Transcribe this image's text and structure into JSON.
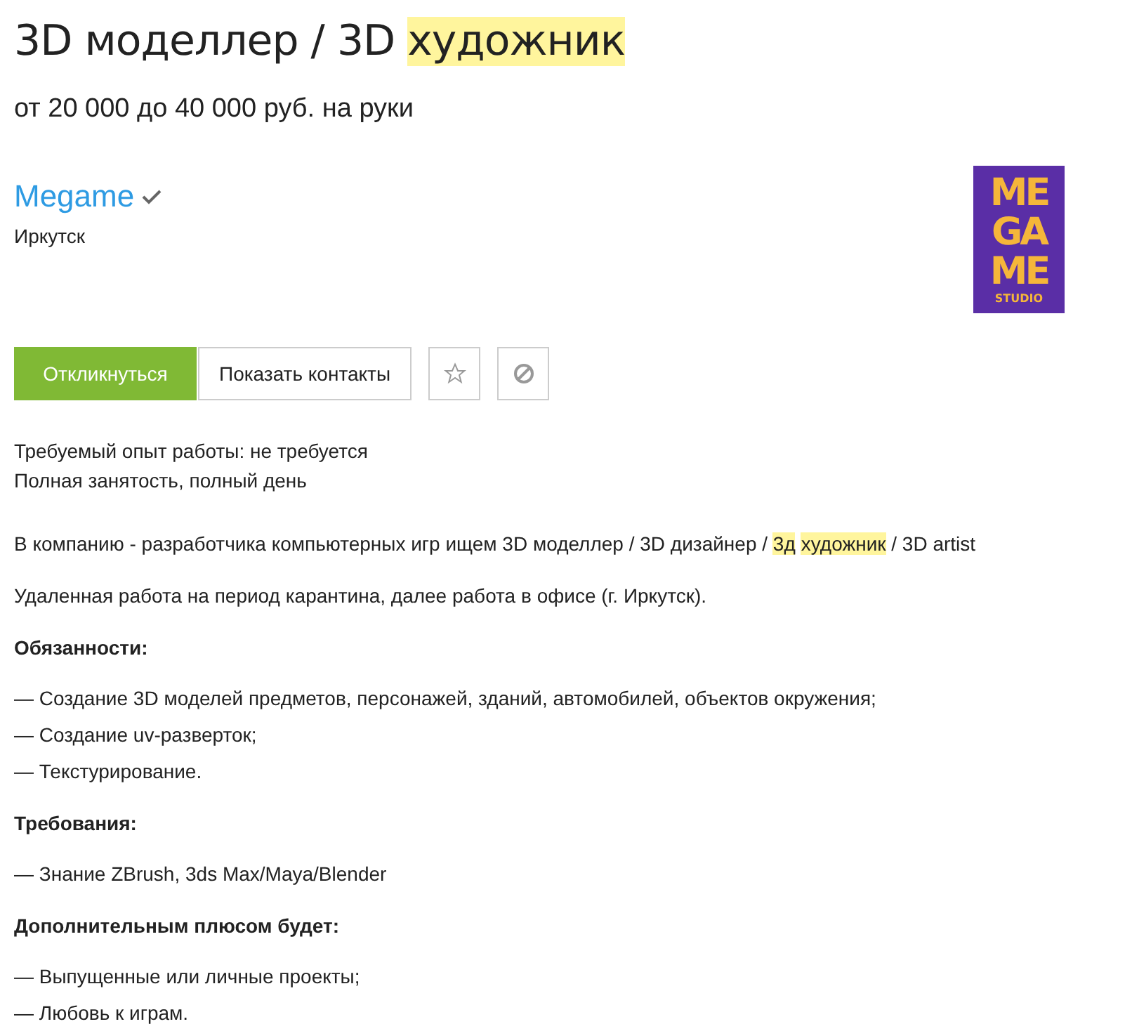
{
  "title": [
    {
      "text": "3D моделлер / 3D ",
      "highlight": false
    },
    {
      "text": "художник",
      "highlight": true
    }
  ],
  "salary": "от 20 000 до 40 000 руб. на руки",
  "company": {
    "name": "Megame",
    "verified": true,
    "city": "Иркутск",
    "logo": [
      "ME",
      "GA",
      "ME",
      "STUDIO"
    ]
  },
  "buttons": {
    "respond": "Откликнуться",
    "contacts": "Показать контакты"
  },
  "requirements": [
    "Требуемый опыт работы: не требуется",
    "Полная занятость, полный день"
  ],
  "description": [
    {
      "kind": "paragraph",
      "parts": [
        {
          "text": "В компанию - разработчика компьютерных игр ищем 3D моделлер / 3D дизайнер / ",
          "highlight": false
        },
        {
          "text": "3д",
          "highlight": true
        },
        {
          "text": "художник",
          "highlight": true
        },
        {
          "text": " / 3D artist",
          "highlight": false
        }
      ]
    },
    {
      "kind": "paragraph",
      "parts": [
        {
          "text": "Удаленная работа на период карантина, далее работа в офисе (г. Иркутск).",
          "highlight": false
        }
      ]
    },
    {
      "kind": "heading",
      "text": "Обязанности:"
    },
    {
      "kind": "list",
      "items": [
        "— Создание 3D моделей предметов, персонажей, зданий, автомобилей, объектов окружения;",
        "— Создание uv-разверток;",
        "— Текстурирование."
      ]
    },
    {
      "kind": "heading",
      "text": "Требования:"
    },
    {
      "kind": "list",
      "items": [
        "— Знание ZBrush, 3ds Max/Maya/Blender"
      ]
    },
    {
      "kind": "heading",
      "text": "Дополнительным плюсом будет:"
    },
    {
      "kind": "list",
      "items": [
        "— Выпущенные или личные проекты;",
        "— Любовь к играм."
      ]
    }
  ]
}
